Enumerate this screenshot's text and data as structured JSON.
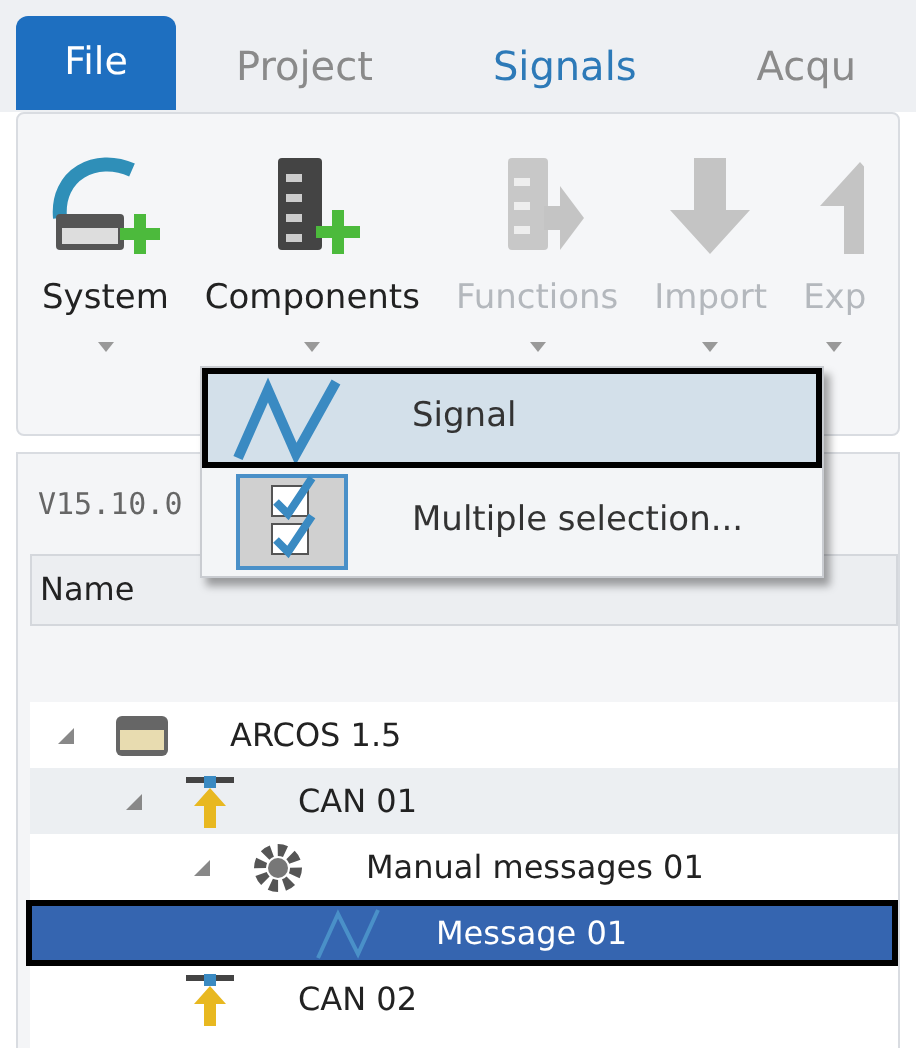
{
  "tabs": [
    {
      "label": "File",
      "kind": "file",
      "selected": false
    },
    {
      "label": "Project",
      "kind": "tab",
      "selected": false
    },
    {
      "label": "Signals",
      "kind": "tab",
      "selected": true
    },
    {
      "label": "Acqu",
      "kind": "tab",
      "selected": false
    }
  ],
  "ribbon": [
    {
      "label": "System",
      "kind": "system",
      "disabled": false
    },
    {
      "label": "Components",
      "kind": "components",
      "disabled": false
    },
    {
      "label": "Functions",
      "kind": "functions",
      "disabled": true
    },
    {
      "label": "Import",
      "kind": "import",
      "disabled": true
    },
    {
      "label": "Exp",
      "kind": "export",
      "disabled": true
    }
  ],
  "version": "V15.10.0",
  "columns": [
    "Name"
  ],
  "menu": [
    {
      "label": "Signal",
      "kind": "signal",
      "selected": true
    },
    {
      "label": "Multiple selection...",
      "kind": "multi",
      "selected": false
    }
  ],
  "tree": [
    {
      "label": "ARCOS 1.5",
      "kind": "system",
      "expanded": true,
      "selected": false,
      "hovered": false,
      "children": [
        {
          "label": "CAN 01",
          "kind": "bus",
          "expanded": true,
          "selected": false,
          "hovered": true,
          "children": [
            {
              "label": "Manual messages 01",
              "kind": "gear",
              "expanded": true,
              "selected": false,
              "hovered": false,
              "children": [
                {
                  "label": "Message 01",
                  "kind": "signal",
                  "selected": true,
                  "hovered": false
                }
              ]
            }
          ]
        },
        {
          "label": "CAN 02",
          "kind": "bus",
          "selected": false,
          "hovered": false
        }
      ]
    }
  ]
}
